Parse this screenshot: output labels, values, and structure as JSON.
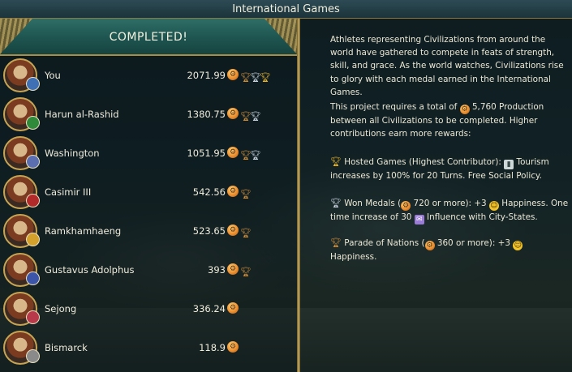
{
  "window": {
    "title": "International Games"
  },
  "banner": {
    "label": "COMPLETED!"
  },
  "leaderboard": [
    {
      "name": "You",
      "score": "2071.99",
      "medals": [
        "bronze",
        "silver",
        "gold"
      ],
      "badge_color": "#3f6fb5"
    },
    {
      "name": "Harun al-Rashid",
      "score": "1380.75",
      "medals": [
        "bronze",
        "silver"
      ],
      "badge_color": "#2f8a3a"
    },
    {
      "name": "Washington",
      "score": "1051.95",
      "medals": [
        "bronze",
        "silver"
      ],
      "badge_color": "#5b6fb0"
    },
    {
      "name": "Casimir III",
      "score": "542.56",
      "medals": [
        "bronze"
      ],
      "badge_color": "#b32a2a"
    },
    {
      "name": "Ramkhamhaeng",
      "score": "523.65",
      "medals": [
        "bronze"
      ],
      "badge_color": "#d4a12c"
    },
    {
      "name": "Gustavus Adolphus",
      "score": "393",
      "medals": [
        "bronze"
      ],
      "badge_color": "#3c55a8"
    },
    {
      "name": "Sejong",
      "score": "336.24",
      "medals": [],
      "badge_color": "#b83a4a"
    },
    {
      "name": "Bismarck",
      "score": "118.9",
      "medals": [],
      "badge_color": "#8a8a8a"
    }
  ],
  "description": {
    "intro": "Athletes representing Civilizations from around the world have gathered to compete in feats of strength, skill, and grace.  As the world watches, Civilizations rise to glory with each medal earned in the International Games.",
    "req_before": "This project requires a total of",
    "req_amount": "5,760 Production",
    "req_after": "between all Civilizations to be completed.  Higher contributions earn more rewards:",
    "hosted_label": "Hosted Games (Highest Contributor):",
    "hosted_text_a": "Tourism",
    "hosted_text_b": "increases by 100% for 20 Turns.  Free Social Policy.",
    "won_label": "Won Medals (",
    "won_amount": "720 or more): +3",
    "won_text_a": "Happiness.",
    "won_text_b": "One time increase of 30",
    "won_text_c": "Influence with City-States.",
    "parade_label": "Parade of Nations (",
    "parade_amount": "360 or more): +3",
    "parade_text": "Happiness."
  }
}
